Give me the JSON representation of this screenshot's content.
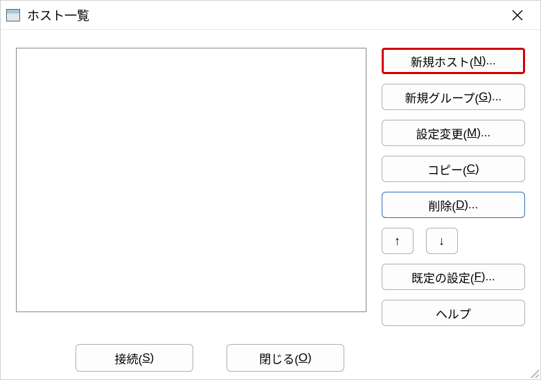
{
  "title": "ホスト一覧",
  "buttons": {
    "new_host": {
      "label": "新規ホスト(",
      "mnemonic": "N",
      "suffix": ")..."
    },
    "new_group": {
      "label": "新規グループ(",
      "mnemonic": "G",
      "suffix": ")..."
    },
    "edit": {
      "label": "設定変更(",
      "mnemonic": "M",
      "suffix": ")..."
    },
    "copy": {
      "label": "コピー(",
      "mnemonic": "C",
      "suffix": ")"
    },
    "delete": {
      "label": "削除(",
      "mnemonic": "D",
      "suffix": ")..."
    },
    "up": "↑",
    "down": "↓",
    "default": {
      "label": "既定の設定(",
      "mnemonic": "F",
      "suffix": ")..."
    },
    "help": "ヘルプ",
    "connect": {
      "label": "接続(",
      "mnemonic": "S",
      "suffix": ")"
    },
    "close": {
      "label": "閉じる(",
      "mnemonic": "O",
      "suffix": ")"
    }
  }
}
